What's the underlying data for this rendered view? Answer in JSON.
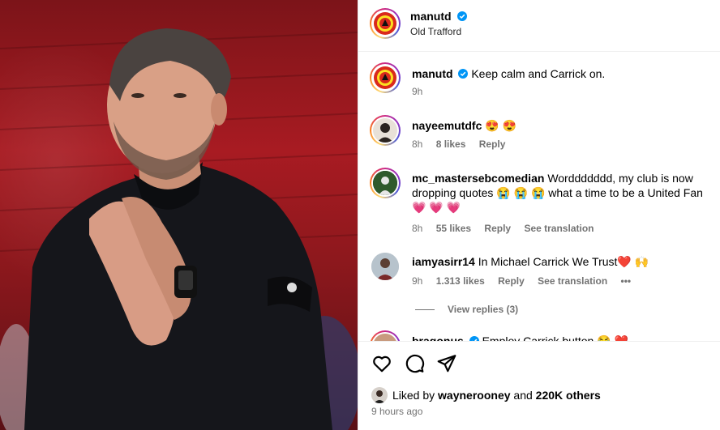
{
  "post": {
    "author": "manutd",
    "location": "Old Trafford"
  },
  "caption": {
    "user": "manutd",
    "text": "Keep calm and Carrick on.",
    "time": "9h"
  },
  "comments": [
    {
      "user": "nayeemutdfc",
      "text": "😍 😍",
      "time": "8h",
      "likes": "8 likes",
      "reply": "Reply"
    },
    {
      "user": "mc_mastersebcomedian",
      "text": "Worddddddd, my club is now dropping quotes 😭 😭 😭  what a time to be a United Fan 💗 💗 💗",
      "time": "8h",
      "likes": "55 likes",
      "reply": "Reply",
      "translate": "See translation"
    },
    {
      "user": "iamyasirr14",
      "text": "In Michael Carrick We Trust❤️ 🙌",
      "time": "9h",
      "likes": "1.313 likes",
      "reply": "Reply",
      "translate": "See translation",
      "more": "•••",
      "view_replies": "View replies (3)"
    },
    {
      "user": "bragonus",
      "text": "Employ Carrick button 😂 ❤️"
    }
  ],
  "footer": {
    "liked_prefix": "Liked by",
    "liked_user": "waynerooney",
    "liked_and": "and",
    "liked_others": "220K others",
    "time": "9 hours ago"
  },
  "icons": {
    "like": "heart-icon",
    "comment": "comment-icon",
    "share": "share-icon",
    "verified": "verified-badge-icon"
  },
  "colors": {
    "verified": "#0095f6",
    "meta": "#737373",
    "border": "#efefef",
    "club_red": "#da291c"
  }
}
